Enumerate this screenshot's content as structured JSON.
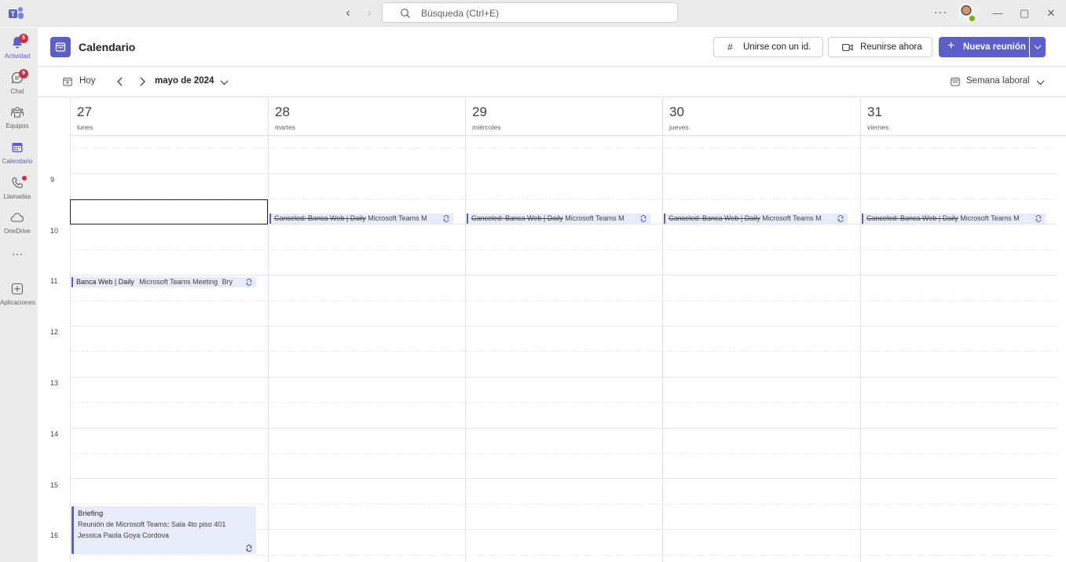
{
  "titlebar": {
    "search_placeholder": "Búsqueda (Ctrl+E)",
    "more": "···"
  },
  "rail": {
    "items": [
      {
        "label": "Actividad",
        "badge": "5"
      },
      {
        "label": "Chat",
        "badge": "9"
      },
      {
        "label": "Equipos"
      },
      {
        "label": "Calendario"
      },
      {
        "label": "Llamadas"
      },
      {
        "label": "OneDrive"
      },
      {
        "label": "Aplicaciones"
      }
    ],
    "more": "···"
  },
  "header": {
    "title": "Calendario",
    "join_id": "Unirse con un id.",
    "meet_now": "Reunirse ahora",
    "new_meeting": "Nueva reunión"
  },
  "toolbar": {
    "today": "Hoy",
    "month": "mayo de 2024",
    "view": "Semana laboral"
  },
  "days": [
    {
      "num": "27",
      "name": "lunes"
    },
    {
      "num": "28",
      "name": "martes"
    },
    {
      "num": "29",
      "name": "miércoles"
    },
    {
      "num": "30",
      "name": "jueves"
    },
    {
      "num": "31",
      "name": "viernes"
    }
  ],
  "hours": [
    "9",
    "10",
    "11",
    "12",
    "13",
    "14",
    "15",
    "16"
  ],
  "events": {
    "canceled_title": "Canceled: Banca Web | Daily",
    "canceled_sub": "Microsoft Teams M",
    "daily_title": "Banca Web | Daily",
    "daily_sub": "Microsoft Teams Meeting",
    "daily_sub2": "Bry",
    "briefing": {
      "title": "Briefing",
      "location": "Reunión de Microsoft Teams; Sala 4to piso 401",
      "organizer": "Jessica Paola Goya Cordova"
    }
  },
  "colors": {
    "accent": "#5b5fc7",
    "badge": "#c4314b",
    "event_bg": "#e8ebfa"
  }
}
